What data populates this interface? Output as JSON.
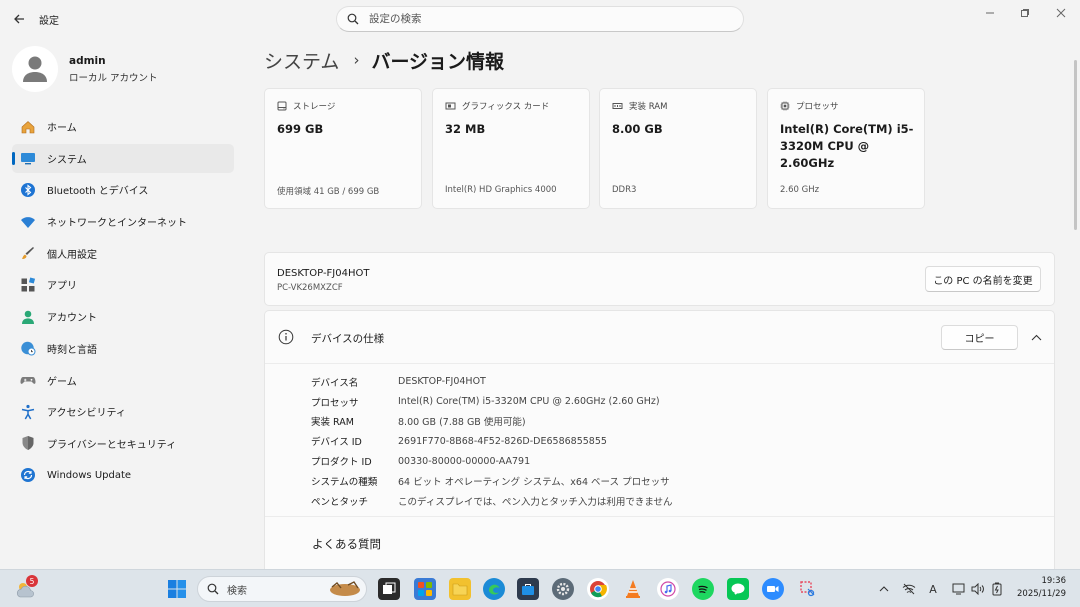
{
  "window": {
    "title": "設定",
    "search_placeholder": "設定の検索"
  },
  "profile": {
    "name": "admin",
    "account_type": "ローカル アカウント"
  },
  "sidebar": {
    "items": [
      {
        "label": "ホーム",
        "icon": "home-icon"
      },
      {
        "label": "システム",
        "icon": "system-icon",
        "active": true
      },
      {
        "label": "Bluetooth とデバイス",
        "icon": "bluetooth-icon"
      },
      {
        "label": "ネットワークとインターネット",
        "icon": "wifi-icon"
      },
      {
        "label": "個人用設定",
        "icon": "brush-icon"
      },
      {
        "label": "アプリ",
        "icon": "apps-icon"
      },
      {
        "label": "アカウント",
        "icon": "account-icon"
      },
      {
        "label": "時刻と言語",
        "icon": "globe-clock-icon"
      },
      {
        "label": "ゲーム",
        "icon": "gamepad-icon"
      },
      {
        "label": "アクセシビリティ",
        "icon": "accessibility-icon"
      },
      {
        "label": "プライバシーとセキュリティ",
        "icon": "shield-icon"
      },
      {
        "label": "Windows Update",
        "icon": "update-icon"
      }
    ]
  },
  "breadcrumb": {
    "parent": "システム",
    "separator": "›",
    "current": "バージョン情報"
  },
  "cards": [
    {
      "label": "ストレージ",
      "value": "699 GB",
      "sub": "使用領域 41 GB / 699 GB",
      "icon": "storage-icon"
    },
    {
      "label": "グラフィックス カード",
      "value": "32 MB",
      "sub": "Intel(R) HD Graphics 4000",
      "icon": "gpu-icon"
    },
    {
      "label": "実装 RAM",
      "value": "8.00 GB",
      "sub": "DDR3",
      "icon": "ram-icon"
    },
    {
      "label": "プロセッサ",
      "value": "Intel(R) Core(TM) i5-3320M CPU @ 2.60GHz",
      "sub": "2.60 GHz",
      "icon": "cpu-icon"
    }
  ],
  "device": {
    "name": "DESKTOP-FJ04HOT",
    "model": "PC-VK26MXZCF",
    "rename_label": "この PC の名前を変更"
  },
  "specs": {
    "title": "デバイスの仕様",
    "copy_label": "コピー",
    "rows": [
      {
        "key": "デバイス名",
        "value": "DESKTOP-FJ04HOT"
      },
      {
        "key": "プロセッサ",
        "value": "Intel(R) Core(TM) i5-3320M CPU @ 2.60GHz (2.60 GHz)"
      },
      {
        "key": "実装 RAM",
        "value": "8.00 GB (7.88 GB 使用可能)"
      },
      {
        "key": "デバイス ID",
        "value": "2691F770-8B68-4F52-826D-DE6586855855"
      },
      {
        "key": "プロダクト ID",
        "value": "00330-80000-00000-AA791"
      },
      {
        "key": "システムの種類",
        "value": "64 ビット オペレーティング システム、x64 ベース プロセッサ"
      },
      {
        "key": "ペンとタッチ",
        "value": "このディスプレイでは、ペン入力とタッチ入力は利用できません"
      }
    ],
    "faq_label": "よくある質問"
  },
  "taskbar": {
    "weather_badge": "5",
    "search_label": "検索",
    "time": "19:36",
    "date": "2025/11/29",
    "ime": "A",
    "accent": "#0067c0"
  }
}
